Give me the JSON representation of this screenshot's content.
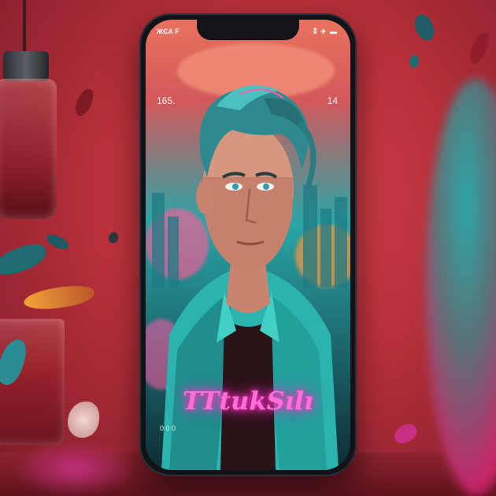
{
  "phone": {
    "status_left": "ЖЄA F",
    "status_right": "⁑ ✈ ▬",
    "side_left": "165.",
    "side_right": "14",
    "bottom_left": "0 0 0",
    "signature": "TTtukSılı"
  },
  "colors": {
    "background": "#c73a45",
    "teal": "#2aa6a7",
    "neon_pink": "#ff6fd8"
  },
  "icons": [
    "signal-icon",
    "wifi-icon",
    "battery-icon"
  ]
}
